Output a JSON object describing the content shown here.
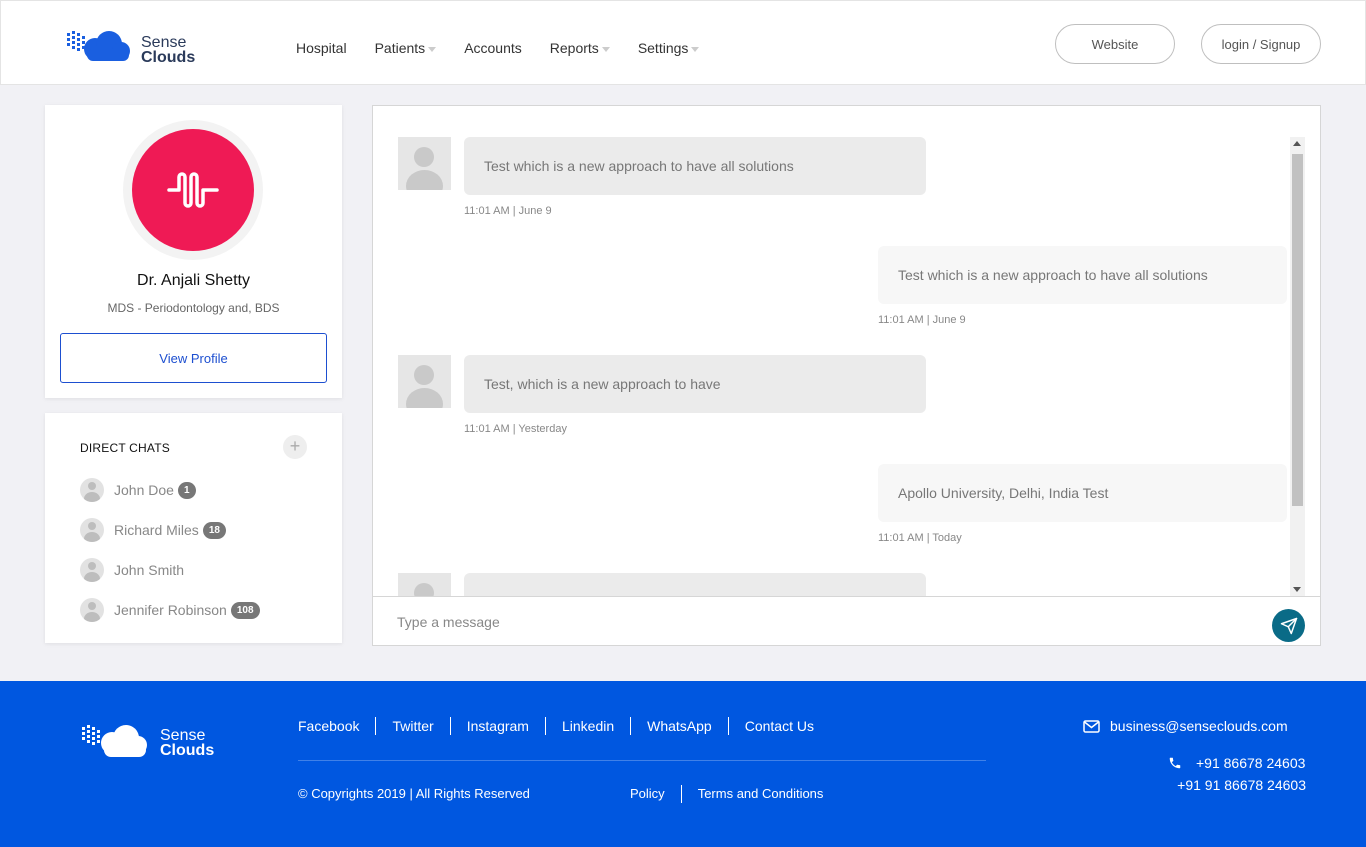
{
  "header": {
    "logo": {
      "line1": "Sense",
      "line2": "Clouds"
    },
    "nav": [
      {
        "label": "Hospital",
        "has_dropdown": false
      },
      {
        "label": "Patients",
        "has_dropdown": true
      },
      {
        "label": "Accounts",
        "has_dropdown": false
      },
      {
        "label": "Reports",
        "has_dropdown": true
      },
      {
        "label": "Settings",
        "has_dropdown": true
      }
    ],
    "website_label": "Website",
    "login_label": "login / Signup"
  },
  "profile": {
    "name": "Dr. Anjali Shetty",
    "degree": "MDS - Periodontology and, BDS",
    "button_label": "View Profile",
    "avatar_color": "#ef1a55"
  },
  "direct_chats": {
    "title": "DIRECT CHATS",
    "add_icon": "plus-icon",
    "contacts": [
      {
        "name": "John Doe",
        "badge": "1"
      },
      {
        "name": "Richard Miles",
        "badge": "18"
      },
      {
        "name": "John Smith",
        "badge": ""
      },
      {
        "name": "Jennifer Robinson",
        "badge": "108"
      }
    ]
  },
  "chat": {
    "messages": [
      {
        "direction": "in",
        "text": "Test which is a new approach to have all solutions",
        "time": "11:01 AM | June 9"
      },
      {
        "direction": "out",
        "text": "Test which is a new approach to have all solutions",
        "time": "11:01 AM | June 9"
      },
      {
        "direction": "in",
        "text": "Test, which is a new approach to have",
        "time": "11:01 AM | Yesterday"
      },
      {
        "direction": "out",
        "text": "Apollo University, Delhi, India Test",
        "time": "11:01 AM | Today"
      }
    ],
    "input_placeholder": "Type a message",
    "send_icon": "send-icon",
    "accent": "#0a6b87"
  },
  "footer": {
    "logo": {
      "line1": "Sense",
      "line2": "Clouds"
    },
    "social_links": [
      "Facebook",
      "Twitter",
      "Instagram",
      "Linkedin",
      "WhatsApp",
      "Contact Us"
    ],
    "copyright": "© Copyrights 2019 | All Rights Reserved",
    "legal_links": [
      "Policy",
      "Terms and Conditions"
    ],
    "email": "business@senseclouds.com",
    "phone1": "+91 86678 24603",
    "phone2": "+91 91 86678 24603",
    "bg_color": "#0057e0"
  }
}
